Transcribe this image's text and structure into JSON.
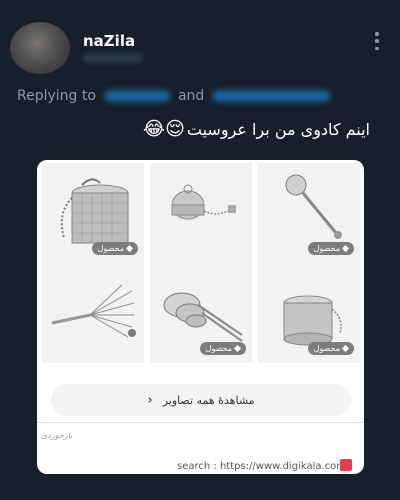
{
  "user": {
    "name": "naZila"
  },
  "reply": {
    "prefix": "Replying to",
    "joiner": "and"
  },
  "tweet": {
    "text": "اینم کادوی من برا عروسیت",
    "emoji": "😌😂"
  },
  "card": {
    "tiles": [
      {
        "tag": "محصول",
        "shape": "tea-infuser-basket"
      },
      {
        "tag": "",
        "shape": "tea-ball-chain"
      },
      {
        "tag": "محصول",
        "shape": "mesh-strainer"
      },
      {
        "tag": "",
        "shape": "whisk-brush"
      },
      {
        "tag": "محصول",
        "shape": "strainer-set"
      },
      {
        "tag": "محصول",
        "shape": "infuser-cup"
      }
    ],
    "view_all_label": "مشاهدهٔ همه تصاویر",
    "archive_label": "بازخوردی",
    "search_text": "search : https://www.digikala.com"
  },
  "colors": {
    "background": "#15202b",
    "link_blue": "#1d9bf0",
    "digikala_red": "#ef394e"
  }
}
